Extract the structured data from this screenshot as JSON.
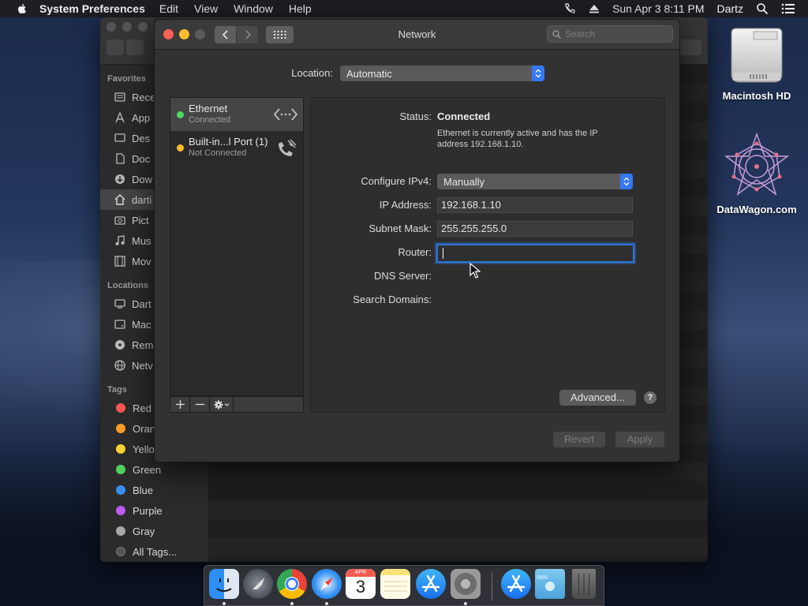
{
  "menubar": {
    "app_name": "System Preferences",
    "menus": [
      "Edit",
      "View",
      "Window",
      "Help"
    ],
    "clock": "Sun Apr 3  8:11 PM",
    "user": "Dartz"
  },
  "finder": {
    "favorites_header": "Favorites",
    "favorites": [
      {
        "label": "Rece",
        "icon": "recents-icon"
      },
      {
        "label": "App",
        "icon": "applications-icon"
      },
      {
        "label": "Des",
        "icon": "desktop-icon"
      },
      {
        "label": "Doc",
        "icon": "documents-icon"
      },
      {
        "label": "Dow",
        "icon": "downloads-icon"
      },
      {
        "label": "darti",
        "icon": "home-icon"
      },
      {
        "label": "Pict",
        "icon": "pictures-icon"
      },
      {
        "label": "Mus",
        "icon": "music-icon"
      },
      {
        "label": "Mov",
        "icon": "movies-icon"
      }
    ],
    "locations_header": "Locations",
    "locations": [
      {
        "label": "Dart",
        "icon": "computer-icon"
      },
      {
        "label": "Mac",
        "icon": "disk-icon"
      },
      {
        "label": "Rem",
        "icon": "remote-disc-icon"
      },
      {
        "label": "Netv",
        "icon": "network-icon"
      }
    ],
    "tags_header": "Tags",
    "tags": [
      {
        "label": "Red",
        "color": "#fc5753"
      },
      {
        "label": "Oran",
        "color": "#fd9e2a"
      },
      {
        "label": "Yello",
        "color": "#fdd435"
      },
      {
        "label": "Green",
        "color": "#4fd35f"
      },
      {
        "label": "Blue",
        "color": "#3b8ef0"
      },
      {
        "label": "Purple",
        "color": "#bf5af2"
      },
      {
        "label": "Gray",
        "color": "#a8a8a8"
      },
      {
        "label": "All Tags...",
        "color": "#555555"
      }
    ]
  },
  "network": {
    "title": "Network",
    "search_placeholder": "Search",
    "location_label": "Location:",
    "location_value": "Automatic",
    "services": [
      {
        "name": "Ethernet",
        "status": "Connected",
        "dot": "#4cd964",
        "icon": "ethernet-icon"
      },
      {
        "name": "Built-in...l Port (1)",
        "status": "Not Connected",
        "dot": "#febc2e",
        "icon": "phone-icon"
      }
    ],
    "status_label": "Status:",
    "status_value": "Connected",
    "status_desc": "Ethernet is currently active and has the IP address 192.168.1.10.",
    "configure_label": "Configure IPv4:",
    "configure_value": "Manually",
    "ip_label": "IP Address:",
    "ip_value": "192.168.1.10",
    "subnet_label": "Subnet Mask:",
    "subnet_value": "255.255.255.0",
    "router_label": "Router:",
    "router_value": "",
    "dns_label": "DNS Server:",
    "search_domains_label": "Search Domains:",
    "advanced_button": "Advanced...",
    "help_button": "?",
    "revert_button": "Revert",
    "apply_button": "Apply"
  },
  "desktop": {
    "icons": [
      {
        "label": "Macintosh HD"
      },
      {
        "label": "DataWagon.com"
      }
    ]
  },
  "dock": {
    "apps": [
      "Finder",
      "Launchpad",
      "Chrome",
      "Safari",
      "Calendar",
      "Notes",
      "App Store",
      "System Preferences",
      "App Store",
      "Downloads",
      "Trash"
    ],
    "calendar_month": "APR",
    "calendar_day": "3"
  },
  "colors": {
    "accent": "#3478f6",
    "close": "#fe5f57",
    "minimize": "#febc2e"
  }
}
